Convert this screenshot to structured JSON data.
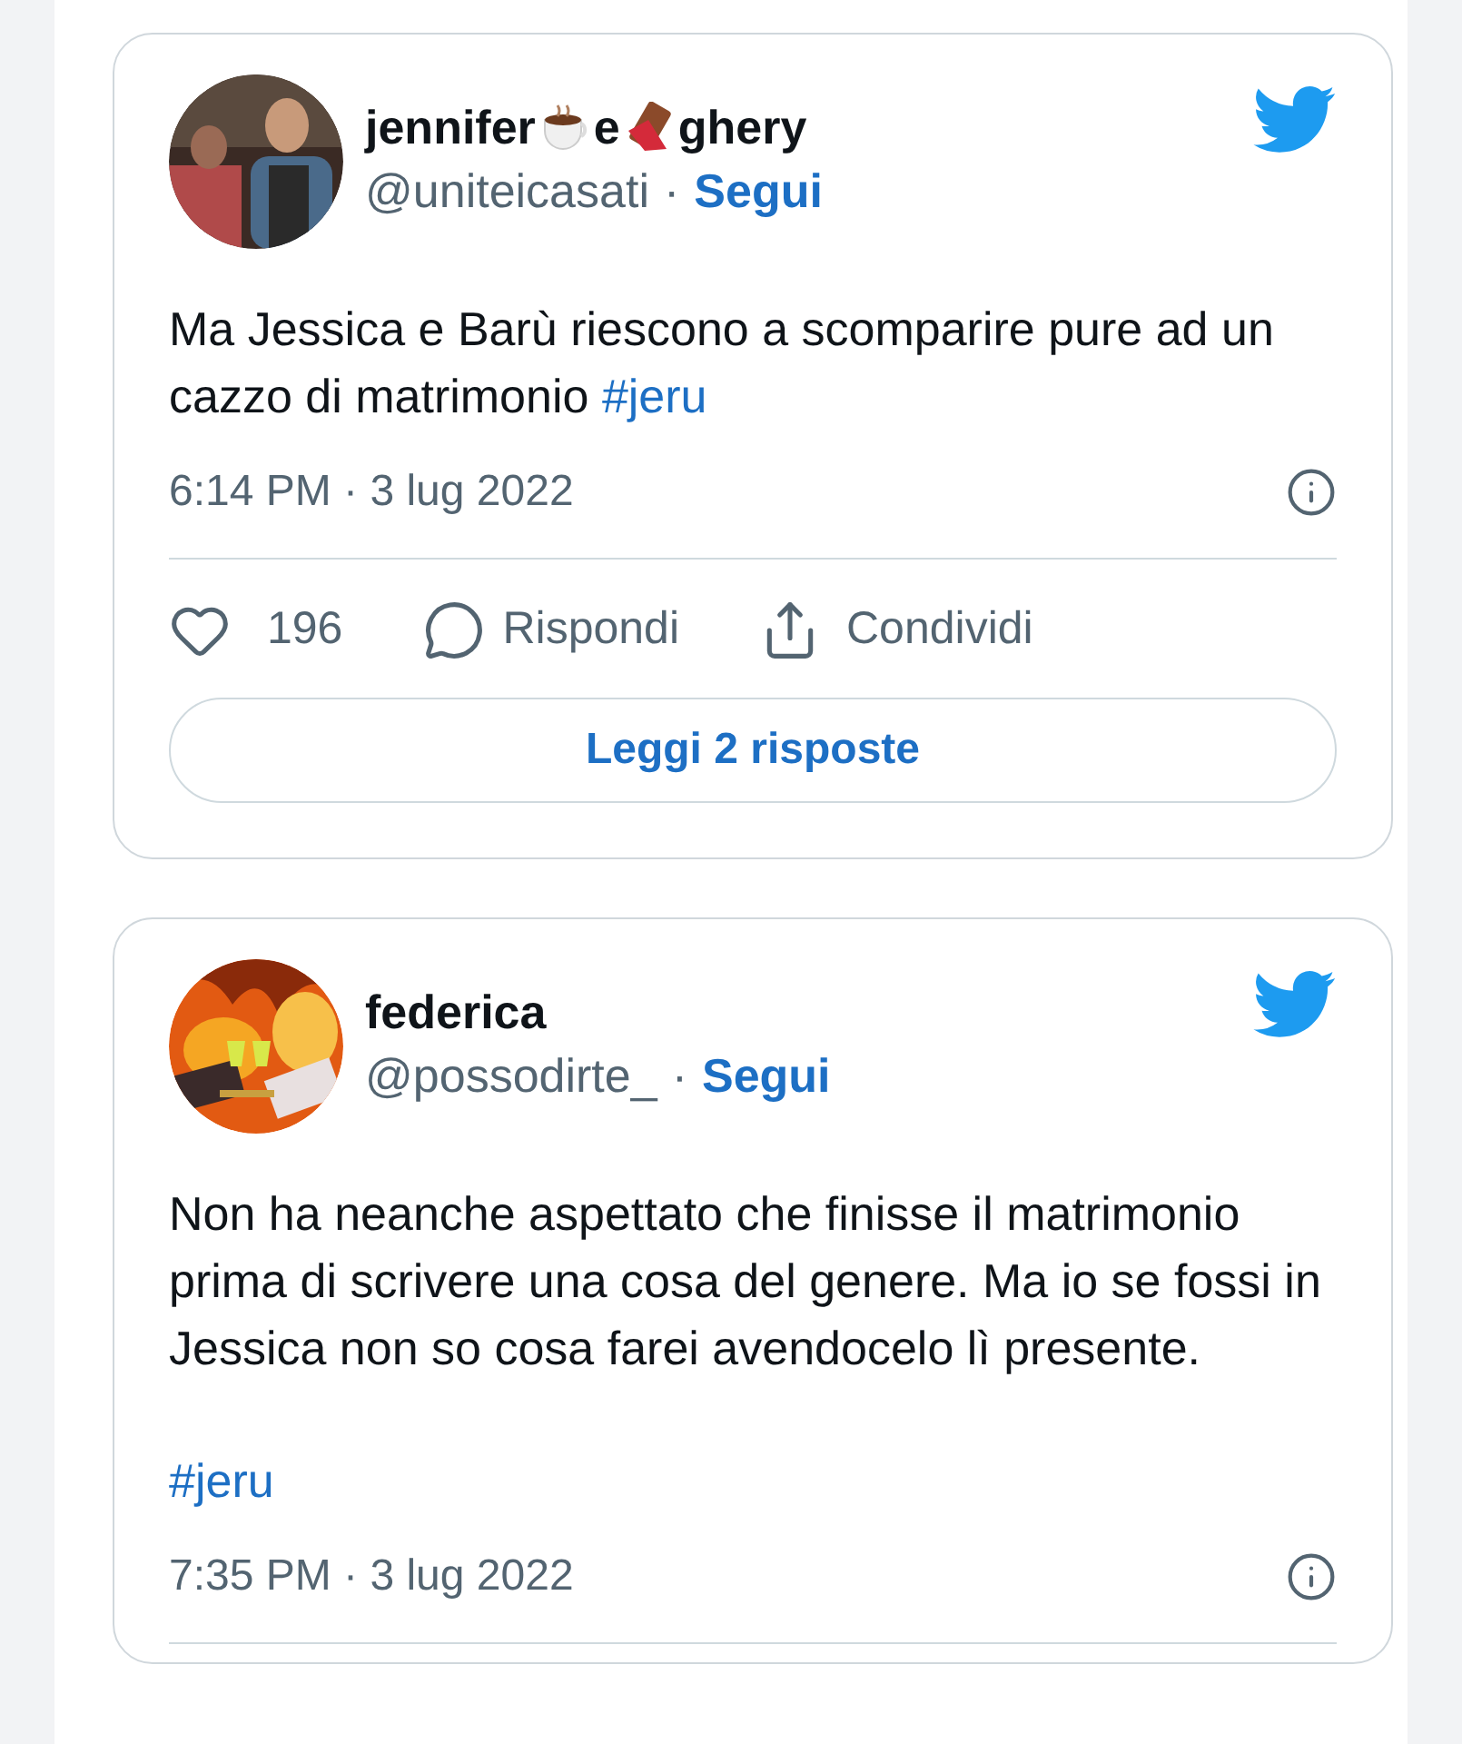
{
  "tweets": [
    {
      "avatar": {
        "kind": "picture"
      },
      "name": [
        {
          "kind": "text",
          "text": "jennifer"
        },
        {
          "kind": "cup"
        },
        {
          "kind": "text",
          "text": "e"
        },
        {
          "kind": "chocolate"
        },
        {
          "kind": "text",
          "text": "ghery"
        }
      ],
      "username": "@uniteicasati",
      "separator": "·",
      "follow": "Segui",
      "body": {
        "text": "Ma Jessica e Barù riescono a scomparire pure ad un cazzo di matrimonio",
        "hashtag": "#jeru"
      },
      "time": "6:14 PM · 3 lug 2022",
      "actions": {
        "likes": "196",
        "reply": "Rispondi",
        "share": "Condividi"
      },
      "replies_button": "Leggi 2 risposte"
    },
    {
      "avatar": {
        "kind": "picture"
      },
      "name": [
        {
          "kind": "text",
          "text": "federica"
        }
      ],
      "username": "@possodirte_",
      "separator": "·",
      "follow": "Segui",
      "body": {
        "text": "Non ha neanche aspettato che finisse il matrimonio prima di scrivere una cosa del genere. Ma io se fossi in Jessica non so cosa farei avendocelo lì presente.",
        "hashtag_line": "#jeru"
      },
      "time": "7:35 PM · 3 lug 2022"
    }
  ]
}
